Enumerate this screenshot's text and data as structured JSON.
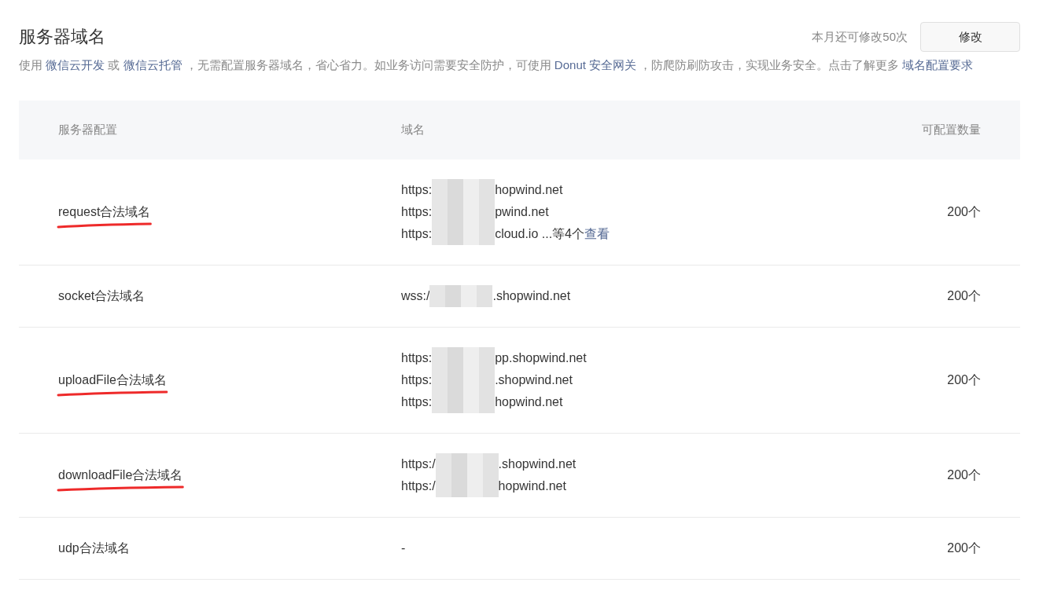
{
  "title": "服务器域名",
  "quota": "本月还可修改50次",
  "edit_button": "修改",
  "description": [
    {
      "kind": "text",
      "text": "使用 "
    },
    {
      "kind": "link",
      "text": "微信云开发"
    },
    {
      "kind": "text",
      "text": " 或 "
    },
    {
      "kind": "link",
      "text": "微信云托管"
    },
    {
      "kind": "text",
      "text": " ，无需配置服务器域名，省心省力。如业务访问需要安全防护，可使用 "
    },
    {
      "kind": "link",
      "text": "Donut 安全网关"
    },
    {
      "kind": "text",
      "text": " ，防爬防刷防攻击，实现业务安全。点击了解更多 "
    },
    {
      "kind": "link",
      "text": "域名配置要求"
    }
  ],
  "table": {
    "columns": [
      "服务器配置",
      "域名",
      "可配置数量"
    ],
    "rows": [
      {
        "name": "request合法域名",
        "marked": true,
        "domains": [
          {
            "prefix": "https:",
            "suffix": "hopwind.net"
          },
          {
            "prefix": "https:",
            "suffix": "pwind.net"
          },
          {
            "prefix": "https:",
            "suffix": "cloud.io ...等4个",
            "link": "查看"
          }
        ],
        "count": "200个"
      },
      {
        "name": "socket合法域名",
        "marked": false,
        "domains": [
          {
            "prefix": "wss:/",
            "suffix": ".shopwind.net"
          }
        ],
        "count": "200个"
      },
      {
        "name": "uploadFile合法域名",
        "marked": true,
        "domains": [
          {
            "prefix": "https:",
            "suffix": "pp.shopwind.net"
          },
          {
            "prefix": "https:",
            "suffix": ".shopwind.net"
          },
          {
            "prefix": "https:",
            "suffix": "hopwind.net"
          }
        ],
        "count": "200个"
      },
      {
        "name": "downloadFile合法域名",
        "marked": true,
        "domains": [
          {
            "prefix": "https:/",
            "suffix": ".shopwind.net"
          },
          {
            "prefix": "https:/",
            "suffix": "hopwind.net"
          }
        ],
        "count": "200个"
      },
      {
        "name": "udp合法域名",
        "marked": false,
        "domains": [],
        "empty": "-",
        "count": "200个"
      }
    ]
  }
}
